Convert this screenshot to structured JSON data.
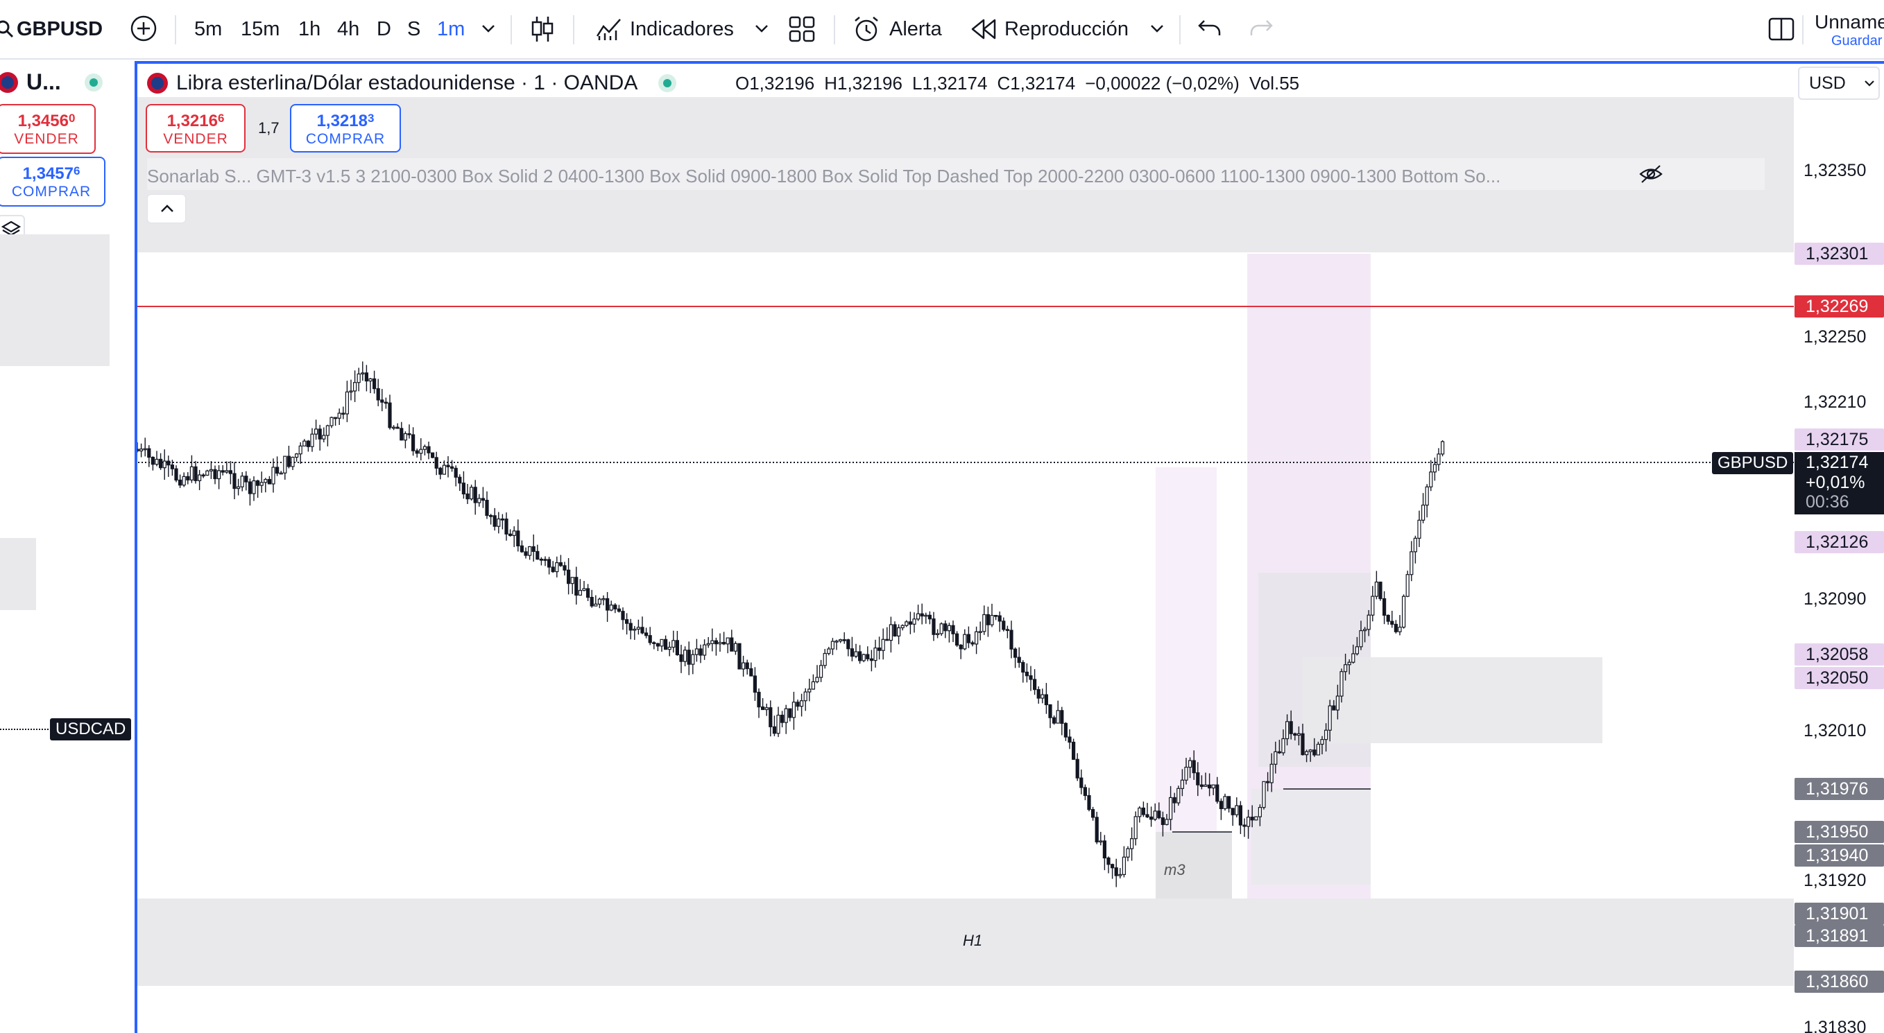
{
  "toolbar": {
    "symbol": "GBPUSD",
    "intervals": [
      "5m",
      "15m",
      "1h",
      "4h",
      "D",
      "S",
      "1m"
    ],
    "active_interval": "1m",
    "indicators_label": "Indicadores",
    "alert_label": "Alerta",
    "replay_label": "Reproducción",
    "layout_name": "Unnamed",
    "save_label": "Guardar"
  },
  "watchlist": {
    "symbol": "U...",
    "sell": {
      "price_main": "1,3456",
      "price_sup": "0",
      "label": "VENDER"
    },
    "buy": {
      "price_main": "1,3457",
      "price_sup": "6",
      "label": "COMPRAR"
    },
    "marker_label": "USDCAD"
  },
  "legend": {
    "title": "Libra esterlina/Dólar estadounidense · 1 · OANDA",
    "open": "O1,32196",
    "high": "H1,32196",
    "low": "L1,32174",
    "close": "C1,32174",
    "change": "−0,00022 (−0,02%)",
    "volume": "Vol.55",
    "sell_price_main": "1,3216",
    "sell_price_sup": "6",
    "sell_label": "VENDER",
    "spread": "1,7",
    "buy_price_main": "1,3218",
    "buy_price_sup": "3",
    "buy_label": "COMPRAR",
    "indicator_text": "Sonarlab S...   GMT-3 v1.5 3 2100-0300 Box Solid 2 0400-1300 Box Solid 0900-1800 Box Solid Top Dashed Top 2000-2200 0300-0600 1100-1300 0900-1300 Bottom So..."
  },
  "axis": {
    "currency": "USD",
    "ticks": [
      "1,32350",
      "1,32250",
      "1,32210",
      "1,32090",
      "1,32010",
      "1,31920",
      "1,31830"
    ],
    "labels": {
      "l_32301": "1,32301",
      "l_32269": "1,32269",
      "l_32175": "1,32175",
      "current_price": "1,32174",
      "current_change": "+0,01%",
      "countdown": "00:36",
      "l_32126": "1,32126",
      "l_32058": "1,32058",
      "l_32050": "1,32050",
      "l_31976": "1,31976",
      "l_31950": "1,31950",
      "l_31940": "1,31940",
      "l_31901": "1,31901",
      "l_31891": "1,31891",
      "l_31860": "1,31860"
    },
    "symbol_tag": "GBPUSD"
  },
  "zones": {
    "h1_label": "H1",
    "m3_label": "m3"
  },
  "colors": {
    "accent": "#2962ff",
    "sell": "#e0303c",
    "zone_gray": "#e9e9ec",
    "zone_pink": "#f3e9f6",
    "label_pink": "#e7d3ef",
    "label_dark": "#131722",
    "label_gray": "#787b86"
  },
  "chart_data": {
    "type": "candlestick",
    "symbol": "GBPUSD",
    "interval": "1",
    "ylim": [
      1.3182,
      1.3239
    ],
    "last_price": 1.32174,
    "candles": []
  }
}
